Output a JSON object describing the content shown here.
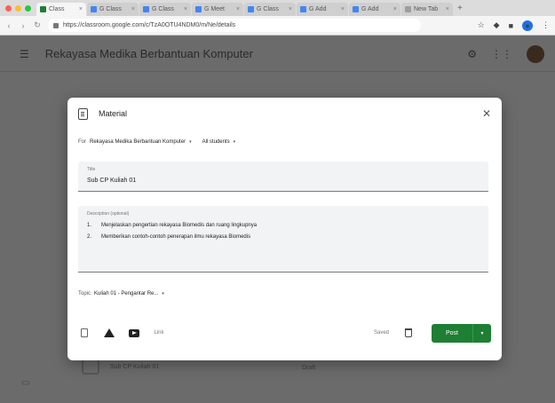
{
  "browser": {
    "traffic_lights": [
      "#ff5f57",
      "#febc2e",
      "#28c840"
    ],
    "tabs": [
      {
        "label": "Class",
        "active": true,
        "favicon_color": "#1e7e34"
      },
      {
        "label": "G Class",
        "active": false,
        "favicon_color": "#4285f4"
      },
      {
        "label": "G Class",
        "active": false,
        "favicon_color": "#4285f4"
      },
      {
        "label": "G Meet",
        "active": false,
        "favicon_color": "#4285f4"
      },
      {
        "label": "G Class",
        "active": false,
        "favicon_color": "#4285f4"
      },
      {
        "label": "G Add",
        "active": false,
        "favicon_color": "#4285f4"
      },
      {
        "label": "G Add",
        "active": false,
        "favicon_color": "#4285f4"
      },
      {
        "label": "New Tab",
        "active": false,
        "favicon_color": "#9e9e9e"
      }
    ],
    "url": "https://classroom.google.com/c/TzA0OTU4NDM0/m/Ne/details"
  },
  "classroom": {
    "class_name": "Rekayasa Medika Berbantuan Komputer",
    "bg_item_title": "Sub CP Kuliah 01",
    "bg_item_badge": "Draft"
  },
  "modal": {
    "title": "Material",
    "for_label": "For",
    "course_value": "Rekayasa Medika Berbantuan Komputer",
    "students_value": "All students",
    "title_field_label": "Title",
    "title_field_value": "Sub CP Kuliah 01",
    "description_label": "Description (optional)",
    "description_items": [
      {
        "num": "1.",
        "text": "Menjelaskan pengertian rekayasa Biomedis dan ruang lingkupnya"
      },
      {
        "num": "2.",
        "text": "Memberikan contoh-contoh penerapan ilmu rekayasa Biomedis"
      }
    ],
    "topic_label": "Topic",
    "topic_value": "Kuliah 01 - Pengantar Re...",
    "link_label": "Link",
    "saved_label": "Saved",
    "post_label": "Post",
    "post_color": "#1e7e34"
  }
}
